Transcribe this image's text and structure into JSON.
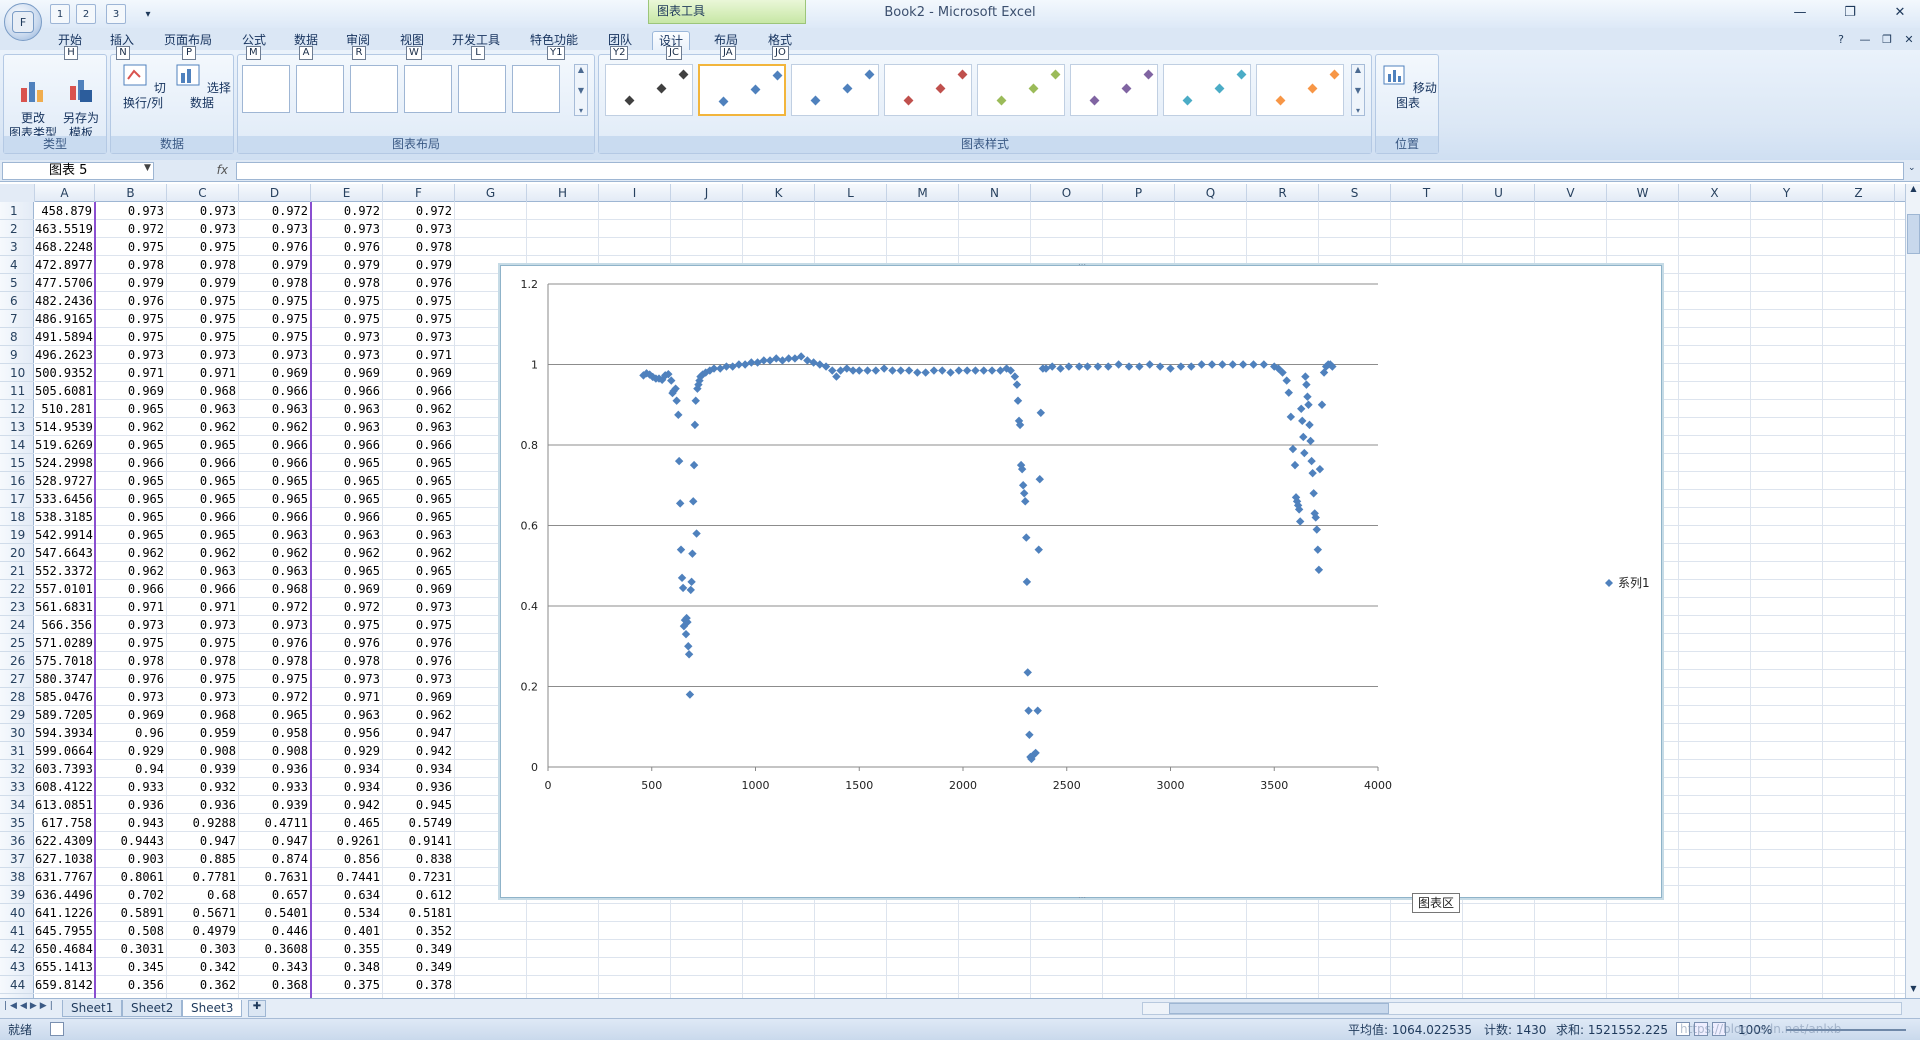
{
  "window": {
    "title": "Book2 - Microsoft Excel",
    "chart_tools_label": "图表工具",
    "controls": [
      "—",
      "❐",
      "✕"
    ],
    "sub_controls": [
      "?",
      "—",
      "❐",
      "✕"
    ]
  },
  "office_button": {
    "label": "F"
  },
  "quick_access": [
    {
      "label": "1",
      "icon": "save-icon"
    },
    {
      "label": "2",
      "icon": "undo-icon"
    },
    {
      "label": "3",
      "icon": "redo-icon"
    },
    {
      "label": "▾",
      "icon": "customize-icon"
    }
  ],
  "tabs": [
    {
      "label": "开始",
      "key": "H"
    },
    {
      "label": "插入",
      "key": "N"
    },
    {
      "label": "页面布局",
      "key": "P"
    },
    {
      "label": "公式",
      "key": "M"
    },
    {
      "label": "数据",
      "key": "A"
    },
    {
      "label": "审阅",
      "key": "R"
    },
    {
      "label": "视图",
      "key": "W"
    },
    {
      "label": "开发工具",
      "key": "L"
    },
    {
      "label": "特色功能",
      "key": "Y1"
    },
    {
      "label": "团队",
      "key": "Y2"
    },
    {
      "label": "设计",
      "key": "JC"
    },
    {
      "label": "布局",
      "key": "JA"
    },
    {
      "label": "格式",
      "key": "JO"
    }
  ],
  "ribbon": {
    "group_type": {
      "label": "类型",
      "btn1": "更改\n图表类型",
      "btn2": "另存为\n模板"
    },
    "group_data": {
      "label": "数据",
      "btn1": "切换行/列",
      "btn2": "选择数据"
    },
    "group_layout": {
      "label": "图表布局"
    },
    "group_styles": {
      "label": "图表样式",
      "colors": [
        "#404040",
        "#4f81bd",
        "#4f81bd",
        "#c0504d",
        "#9bbb59",
        "#8064a2",
        "#4bacc6",
        "#f79646"
      ]
    },
    "group_location": {
      "label": "位置",
      "btn1": "移动图表"
    }
  },
  "formula_bar": {
    "name_box": "图表 5",
    "fx": "fx",
    "value": ""
  },
  "columns": [
    "A",
    "B",
    "C",
    "D",
    "E",
    "F",
    "G",
    "H",
    "I",
    "J",
    "K",
    "L",
    "M",
    "N",
    "O",
    "P",
    "Q",
    "R",
    "S",
    "T",
    "U",
    "V",
    "W",
    "X",
    "Y",
    "Z"
  ],
  "rows": [
    [
      "458.879",
      "0.973",
      "0.973",
      "0.972",
      "0.972",
      "0.972"
    ],
    [
      "463.5519",
      "0.972",
      "0.973",
      "0.973",
      "0.973",
      "0.973"
    ],
    [
      "468.2248",
      "0.975",
      "0.975",
      "0.976",
      "0.976",
      "0.978"
    ],
    [
      "472.8977",
      "0.978",
      "0.978",
      "0.979",
      "0.979",
      "0.979"
    ],
    [
      "477.5706",
      "0.979",
      "0.979",
      "0.978",
      "0.978",
      "0.976"
    ],
    [
      "482.2436",
      "0.976",
      "0.975",
      "0.975",
      "0.975",
      "0.975"
    ],
    [
      "486.9165",
      "0.975",
      "0.975",
      "0.975",
      "0.975",
      "0.975"
    ],
    [
      "491.5894",
      "0.975",
      "0.975",
      "0.975",
      "0.973",
      "0.973"
    ],
    [
      "496.2623",
      "0.973",
      "0.973",
      "0.973",
      "0.973",
      "0.971"
    ],
    [
      "500.9352",
      "0.971",
      "0.971",
      "0.969",
      "0.969",
      "0.969"
    ],
    [
      "505.6081",
      "0.969",
      "0.968",
      "0.966",
      "0.966",
      "0.966"
    ],
    [
      "510.281",
      "0.965",
      "0.963",
      "0.963",
      "0.963",
      "0.962"
    ],
    [
      "514.9539",
      "0.962",
      "0.962",
      "0.962",
      "0.963",
      "0.963"
    ],
    [
      "519.6269",
      "0.965",
      "0.965",
      "0.966",
      "0.966",
      "0.966"
    ],
    [
      "524.2998",
      "0.966",
      "0.966",
      "0.966",
      "0.965",
      "0.965"
    ],
    [
      "528.9727",
      "0.965",
      "0.965",
      "0.965",
      "0.965",
      "0.965"
    ],
    [
      "533.6456",
      "0.965",
      "0.965",
      "0.965",
      "0.965",
      "0.965"
    ],
    [
      "538.3185",
      "0.965",
      "0.966",
      "0.966",
      "0.966",
      "0.965"
    ],
    [
      "542.9914",
      "0.965",
      "0.965",
      "0.963",
      "0.963",
      "0.963"
    ],
    [
      "547.6643",
      "0.962",
      "0.962",
      "0.962",
      "0.962",
      "0.962"
    ],
    [
      "552.3372",
      "0.962",
      "0.963",
      "0.963",
      "0.965",
      "0.965"
    ],
    [
      "557.0101",
      "0.966",
      "0.966",
      "0.968",
      "0.969",
      "0.969"
    ],
    [
      "561.6831",
      "0.971",
      "0.971",
      "0.972",
      "0.972",
      "0.973"
    ],
    [
      "566.356",
      "0.973",
      "0.973",
      "0.973",
      "0.975",
      "0.975"
    ],
    [
      "571.0289",
      "0.975",
      "0.975",
      "0.976",
      "0.976",
      "0.976"
    ],
    [
      "575.7018",
      "0.978",
      "0.978",
      "0.978",
      "0.978",
      "0.976"
    ],
    [
      "580.3747",
      "0.976",
      "0.975",
      "0.975",
      "0.973",
      "0.973"
    ],
    [
      "585.0476",
      "0.973",
      "0.973",
      "0.972",
      "0.971",
      "0.969"
    ],
    [
      "589.7205",
      "0.969",
      "0.968",
      "0.965",
      "0.963",
      "0.962"
    ],
    [
      "594.3934",
      "0.96",
      "0.959",
      "0.958",
      "0.956",
      "0.947"
    ],
    [
      "599.0664",
      "0.929",
      "0.908",
      "0.908",
      "0.929",
      "0.942"
    ],
    [
      "603.7393",
      "0.94",
      "0.939",
      "0.936",
      "0.934",
      "0.934"
    ],
    [
      "608.4122",
      "0.933",
      "0.932",
      "0.933",
      "0.934",
      "0.936"
    ],
    [
      "613.0851",
      "0.936",
      "0.936",
      "0.939",
      "0.942",
      "0.945"
    ],
    [
      "617.758",
      "0.943",
      "0.9288",
      "0.4711",
      "0.465",
      "0.5749"
    ],
    [
      "622.4309",
      "0.9443",
      "0.947",
      "0.947",
      "0.9261",
      "0.9141"
    ],
    [
      "627.1038",
      "0.903",
      "0.885",
      "0.874",
      "0.856",
      "0.838"
    ],
    [
      "631.7767",
      "0.8061",
      "0.7781",
      "0.7631",
      "0.7441",
      "0.7231"
    ],
    [
      "636.4496",
      "0.702",
      "0.68",
      "0.657",
      "0.634",
      "0.612"
    ],
    [
      "641.1226",
      "0.5891",
      "0.5671",
      "0.5401",
      "0.534",
      "0.5181"
    ],
    [
      "645.7955",
      "0.508",
      "0.4979",
      "0.446",
      "0.401",
      "0.352"
    ],
    [
      "650.4684",
      "0.3031",
      "0.303",
      "0.3608",
      "0.355",
      "0.349"
    ],
    [
      "655.1413",
      "0.345",
      "0.342",
      "0.343",
      "0.348",
      "0.349"
    ],
    [
      "659.8142",
      "0.356",
      "0.362",
      "0.368",
      "0.375",
      "0.378"
    ]
  ],
  "chart_data": {
    "type": "scatter",
    "title": "",
    "xlim": [
      0,
      4000
    ],
    "ylim": [
      0,
      1.2
    ],
    "x_ticks": [
      "0",
      "500",
      "1000",
      "1500",
      "2000",
      "2500",
      "3000",
      "3500",
      "4000"
    ],
    "y_ticks": [
      "0",
      "0.2",
      "0.4",
      "0.6",
      "0.8",
      "1",
      "1.2"
    ],
    "grid": "horizontal major",
    "legend": "right",
    "series": [
      {
        "name": "系列1",
        "color": "#4f81bd",
        "marker": "diamond",
        "points": [
          [
            460,
            0.973
          ],
          [
            475,
            0.978
          ],
          [
            490,
            0.975
          ],
          [
            505,
            0.969
          ],
          [
            520,
            0.965
          ],
          [
            535,
            0.965
          ],
          [
            550,
            0.962
          ],
          [
            565,
            0.973
          ],
          [
            580,
            0.976
          ],
          [
            594,
            0.96
          ],
          [
            600,
            0.929
          ],
          [
            605,
            0.934
          ],
          [
            615,
            0.94
          ],
          [
            620,
            0.91
          ],
          [
            628,
            0.875
          ],
          [
            632,
            0.76
          ],
          [
            637,
            0.655
          ],
          [
            641,
            0.54
          ],
          [
            646,
            0.47
          ],
          [
            651,
            0.445
          ],
          [
            655,
            0.35
          ],
          [
            660,
            0.365
          ],
          [
            665,
            0.33
          ],
          [
            668,
            0.37
          ],
          [
            672,
            0.36
          ],
          [
            676,
            0.3
          ],
          [
            680,
            0.28
          ],
          [
            684,
            0.18
          ],
          [
            688,
            0.44
          ],
          [
            692,
            0.46
          ],
          [
            696,
            0.53
          ],
          [
            700,
            0.66
          ],
          [
            704,
            0.75
          ],
          [
            708,
            0.85
          ],
          [
            712,
            0.91
          ],
          [
            716,
            0.58
          ],
          [
            720,
            0.94
          ],
          [
            725,
            0.95
          ],
          [
            730,
            0.96
          ],
          [
            735,
            0.97
          ],
          [
            745,
            0.975
          ],
          [
            760,
            0.98
          ],
          [
            780,
            0.985
          ],
          [
            800,
            0.99
          ],
          [
            830,
            0.99
          ],
          [
            860,
            0.995
          ],
          [
            890,
            0.995
          ],
          [
            920,
            1.0
          ],
          [
            950,
            1.0
          ],
          [
            980,
            1.005
          ],
          [
            1010,
            1.005
          ],
          [
            1040,
            1.01
          ],
          [
            1070,
            1.01
          ],
          [
            1100,
            1.015
          ],
          [
            1130,
            1.01
          ],
          [
            1160,
            1.015
          ],
          [
            1190,
            1.015
          ],
          [
            1220,
            1.02
          ],
          [
            1250,
            1.01
          ],
          [
            1280,
            1.005
          ],
          [
            1310,
            1.0
          ],
          [
            1340,
            0.995
          ],
          [
            1370,
            0.985
          ],
          [
            1390,
            0.97
          ],
          [
            1410,
            0.985
          ],
          [
            1440,
            0.99
          ],
          [
            1470,
            0.985
          ],
          [
            1500,
            0.985
          ],
          [
            1540,
            0.985
          ],
          [
            1580,
            0.985
          ],
          [
            1620,
            0.99
          ],
          [
            1660,
            0.985
          ],
          [
            1700,
            0.985
          ],
          [
            1740,
            0.985
          ],
          [
            1780,
            0.98
          ],
          [
            1820,
            0.98
          ],
          [
            1860,
            0.985
          ],
          [
            1900,
            0.985
          ],
          [
            1940,
            0.98
          ],
          [
            1980,
            0.985
          ],
          [
            2020,
            0.985
          ],
          [
            2060,
            0.985
          ],
          [
            2100,
            0.985
          ],
          [
            2140,
            0.985
          ],
          [
            2180,
            0.985
          ],
          [
            2210,
            0.99
          ],
          [
            2230,
            0.985
          ],
          [
            2250,
            0.97
          ],
          [
            2260,
            0.95
          ],
          [
            2265,
            0.91
          ],
          [
            2270,
            0.86
          ],
          [
            2275,
            0.85
          ],
          [
            2280,
            0.75
          ],
          [
            2285,
            0.74
          ],
          [
            2290,
            0.7
          ],
          [
            2295,
            0.68
          ],
          [
            2300,
            0.66
          ],
          [
            2305,
            0.57
          ],
          [
            2308,
            0.46
          ],
          [
            2312,
            0.235
          ],
          [
            2316,
            0.14
          ],
          [
            2320,
            0.08
          ],
          [
            2325,
            0.025
          ],
          [
            2330,
            0.02
          ],
          [
            2340,
            0.03
          ],
          [
            2350,
            0.035
          ],
          [
            2360,
            0.14
          ],
          [
            2365,
            0.54
          ],
          [
            2370,
            0.715
          ],
          [
            2375,
            0.88
          ],
          [
            2385,
            0.99
          ],
          [
            2400,
            0.99
          ],
          [
            2430,
            0.995
          ],
          [
            2470,
            0.99
          ],
          [
            2510,
            0.995
          ],
          [
            2560,
            0.995
          ],
          [
            2600,
            0.995
          ],
          [
            2650,
            0.995
          ],
          [
            2700,
            0.995
          ],
          [
            2750,
            1.0
          ],
          [
            2800,
            0.995
          ],
          [
            2850,
            0.995
          ],
          [
            2900,
            1.0
          ],
          [
            2950,
            0.995
          ],
          [
            3000,
            0.99
          ],
          [
            3050,
            0.995
          ],
          [
            3100,
            0.995
          ],
          [
            3150,
            1.0
          ],
          [
            3200,
            1.0
          ],
          [
            3250,
            1.0
          ],
          [
            3300,
            1.0
          ],
          [
            3350,
            1.0
          ],
          [
            3400,
            1.0
          ],
          [
            3450,
            1.0
          ],
          [
            3500,
            0.995
          ],
          [
            3520,
            0.99
          ],
          [
            3540,
            0.98
          ],
          [
            3560,
            0.96
          ],
          [
            3570,
            0.93
          ],
          [
            3580,
            0.87
          ],
          [
            3590,
            0.79
          ],
          [
            3600,
            0.75
          ],
          [
            3605,
            0.67
          ],
          [
            3610,
            0.66
          ],
          [
            3615,
            0.65
          ],
          [
            3620,
            0.64
          ],
          [
            3625,
            0.61
          ],
          [
            3630,
            0.89
          ],
          [
            3635,
            0.86
          ],
          [
            3640,
            0.82
          ],
          [
            3645,
            0.78
          ],
          [
            3650,
            0.97
          ],
          [
            3655,
            0.95
          ],
          [
            3660,
            0.92
          ],
          [
            3665,
            0.9
          ],
          [
            3670,
            0.85
          ],
          [
            3675,
            0.81
          ],
          [
            3680,
            0.76
          ],
          [
            3685,
            0.73
          ],
          [
            3690,
            0.68
          ],
          [
            3695,
            0.63
          ],
          [
            3700,
            0.62
          ],
          [
            3705,
            0.59
          ],
          [
            3710,
            0.54
          ],
          [
            3715,
            0.49
          ],
          [
            3720,
            0.74
          ],
          [
            3730,
            0.9
          ],
          [
            3740,
            0.98
          ],
          [
            3750,
            0.995
          ],
          [
            3760,
            1.0
          ],
          [
            3770,
            1.0
          ],
          [
            3780,
            0.995
          ]
        ]
      }
    ]
  },
  "chart_tooltip": "图表区",
  "sheets": [
    "Sheet1",
    "Sheet2",
    "Sheet3"
  ],
  "status": {
    "ready": "就绪",
    "average": "平均值: 1064.022535",
    "count": "计数: 1430",
    "sum": "求和: 1521552.225",
    "zoom": "100%",
    "watermark": "https://blog.csdn.net/anlxb"
  }
}
